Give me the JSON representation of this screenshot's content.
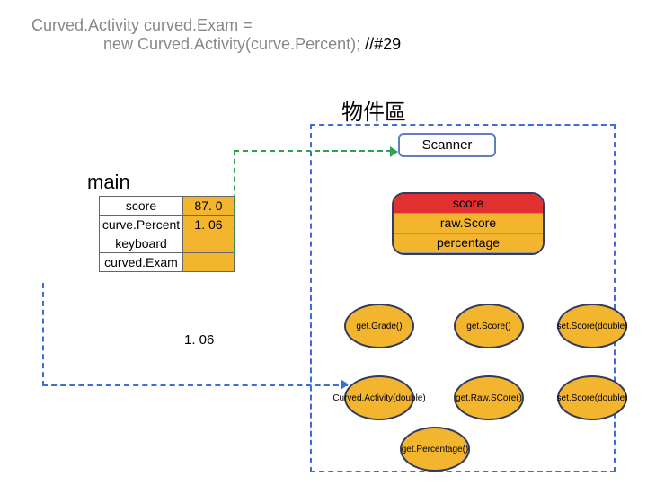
{
  "code": {
    "line1_grey": "Curved.Activity curved.Exam =",
    "line2_grey_a": "new Curved.Activity(curve.Percent);",
    "line2_black": " //#29"
  },
  "labels": {
    "object_area": "物件區",
    "scanner": "Scanner",
    "main": "main"
  },
  "main_vars": {
    "rows": [
      {
        "name": "score",
        "value": "87. 0"
      },
      {
        "name": "curve.Percent",
        "value": "1. 06"
      },
      {
        "name": "keyboard",
        "value": ""
      },
      {
        "name": "curved.Exam",
        "value": ""
      }
    ]
  },
  "object": {
    "header": "score",
    "fields": [
      "raw.Score",
      "percentage"
    ]
  },
  "methods": {
    "m1": "get.Grade()",
    "m2": "get.Score()",
    "m3": "set.Score(double)",
    "m4": "Curved.Activity(double)",
    "m5": "get.Raw.SCore()",
    "m6": "set.Score(double)",
    "m7": "get.Percentage()"
  },
  "floating_value": "1. 06"
}
